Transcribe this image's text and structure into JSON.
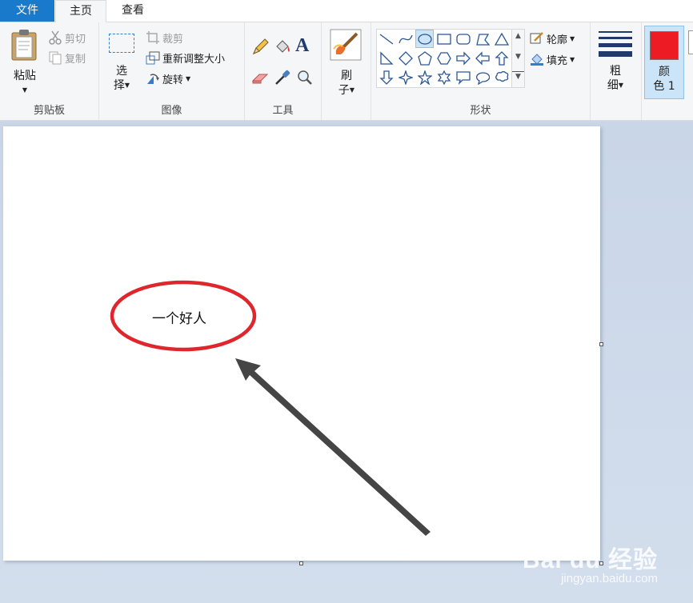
{
  "tabs": {
    "file": "文件",
    "home": "主页",
    "view": "查看"
  },
  "clipboard": {
    "paste": "粘贴",
    "cut": "剪切",
    "copy": "复制",
    "label": "剪贴板"
  },
  "image": {
    "select_1": "选",
    "select_2": "择",
    "crop": "裁剪",
    "resize": "重新调整大小",
    "rotate": "旋转",
    "label": "图像"
  },
  "tools": {
    "label": "工具"
  },
  "brushes": {
    "label_1": "刷",
    "label_2": "子"
  },
  "shapes": {
    "label": "形状",
    "outline": "轮廓",
    "fill": "填充"
  },
  "size": {
    "label_1": "粗",
    "label_2": "细"
  },
  "color1": {
    "label_1": "颜",
    "label_2": "色 1",
    "value": "#ed1c24"
  },
  "canvas": {
    "ellipse_text": "一个好人",
    "ellipse_color": "#e0262d",
    "arrow_color": "#454545"
  },
  "watermark": {
    "main": "Bai du 经验",
    "sub": "jingyan.baidu.com"
  },
  "colors": {
    "accent": "#1979ca",
    "ribbon_bg": "#f5f6f7",
    "selected": "#cce4f7"
  }
}
